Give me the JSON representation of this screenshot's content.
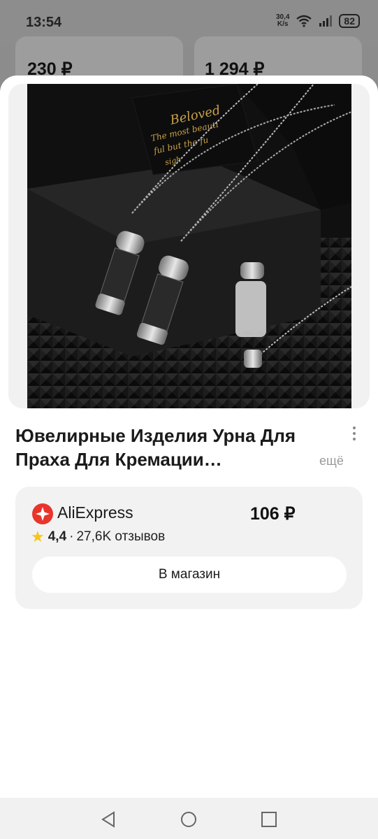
{
  "status_bar": {
    "time": "13:54",
    "net_speed_value": "30,4",
    "net_speed_unit": "K/s",
    "battery": "82"
  },
  "background_cards": {
    "left_price": "230 ₽",
    "right_price": "1 294 ₽"
  },
  "product": {
    "title": "Ювелирные Изделия Урна Для Праха Для Кремации…",
    "more_label": "ещё",
    "image_caption_lines": [
      "Beloved",
      "The most beauti",
      "ful but the fu",
      "sigh"
    ]
  },
  "offer": {
    "shop_name": "AliExpress",
    "price": "106 ₽",
    "rating": "4,4",
    "separator": "·",
    "reviews": "27,6K отзывов",
    "button_label": "В магазин"
  },
  "nav_icons": [
    "back-icon",
    "home-icon",
    "recents-icon"
  ],
  "colors": {
    "accent_shop": "#e8352c",
    "star": "#f5c518",
    "overlay": "#8c8c8c"
  }
}
